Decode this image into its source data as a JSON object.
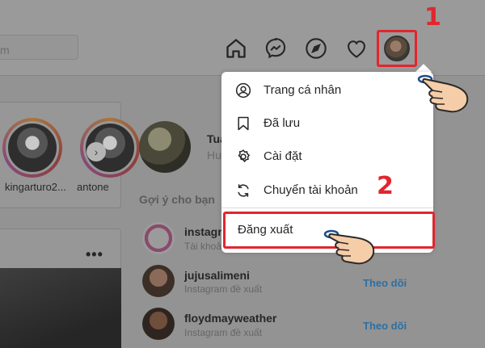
{
  "header": {
    "search_placeholder": "m"
  },
  "nav_icons": [
    "home-icon",
    "messenger-icon",
    "explore-icon",
    "heart-icon"
  ],
  "steps": {
    "step1": "1",
    "step2": "2"
  },
  "stories": [
    {
      "name": "kingarturo2..."
    },
    {
      "name": "antone"
    }
  ],
  "profile": {
    "name": "Tua",
    "sub": "Hu"
  },
  "suggestions": {
    "title": "Gợi ý cho bạn",
    "items": [
      {
        "name": "instagram",
        "sub": "Tài khoản Instagram chính thức",
        "follow": ""
      },
      {
        "name": "jujusalimeni",
        "sub": "Instagram đề xuất",
        "follow": "Theo dõi"
      },
      {
        "name": "floydmayweather",
        "sub": "Instagram đề xuất",
        "follow": "Theo dõi"
      }
    ]
  },
  "dropdown": {
    "items": [
      {
        "label": "Trang cá nhân",
        "icon": "profile-icon"
      },
      {
        "label": "Đã lưu",
        "icon": "bookmark-icon"
      },
      {
        "label": "Cài đặt",
        "icon": "settings-icon"
      },
      {
        "label": "Chuyển tài khoản",
        "icon": "switch-account-icon"
      }
    ],
    "logout_label": "Đăng xuất"
  },
  "colors": {
    "highlight": "#e0262e",
    "follow": "#2e6fa0"
  }
}
